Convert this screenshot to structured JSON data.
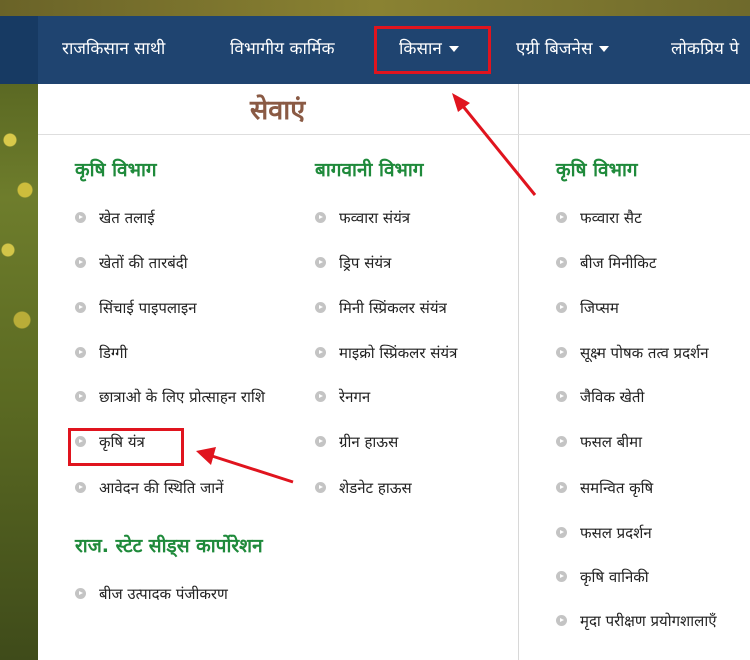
{
  "nav": {
    "items": [
      {
        "label": "राजकिसान साथी",
        "caret": false
      },
      {
        "label": "विभागीय कार्मिक",
        "caret": false
      },
      {
        "label": "किसान",
        "caret": true
      },
      {
        "label": "एग्री बिजनेस",
        "caret": true
      },
      {
        "label": "लोकप्रिय पे",
        "caret": false
      }
    ]
  },
  "dropdown": {
    "title": "सेवाएं",
    "col1": {
      "heading": "कृषि विभाग",
      "items": [
        "खेत तलाई",
        "खेतों की तारबंदी",
        "सिंचाई पाइपलाइन",
        "डिग्गी",
        "छात्राओ के लिए प्रोत्साहन राशि",
        "कृषि यंत्र",
        "आवेदन की स्थिति जानें"
      ],
      "heading2": "राज. स्टेट सीड्स कार्पोरेशन",
      "items2": [
        "बीज उत्पादक पंजीकरण"
      ]
    },
    "col2": {
      "heading": "बागवानी विभाग",
      "items": [
        "फव्वारा संयंत्र",
        "ड्रिप संयंत्र",
        "मिनी स्प्रिंकलर संयंत्र",
        "माइक्रो स्प्रिंकलर संयंत्र",
        "रेनगन",
        "ग्रीन हाऊस",
        "शेडनेट हाऊस"
      ]
    },
    "col3": {
      "heading": "कृषि विभाग",
      "items": [
        "फव्वारा सैट",
        "बीज मिनीकिट",
        "जिप्सम",
        "सूक्ष्म पोषक तत्व प्रदर्शन",
        "जैविक खेती",
        "फसल बीमा",
        "समन्वित कृषि",
        "फसल प्रदर्शन",
        "कृषि वानिकी",
        "मृदा परीक्षण प्रयोगशालाएँ"
      ]
    }
  },
  "annotation_color": "#e0141e"
}
